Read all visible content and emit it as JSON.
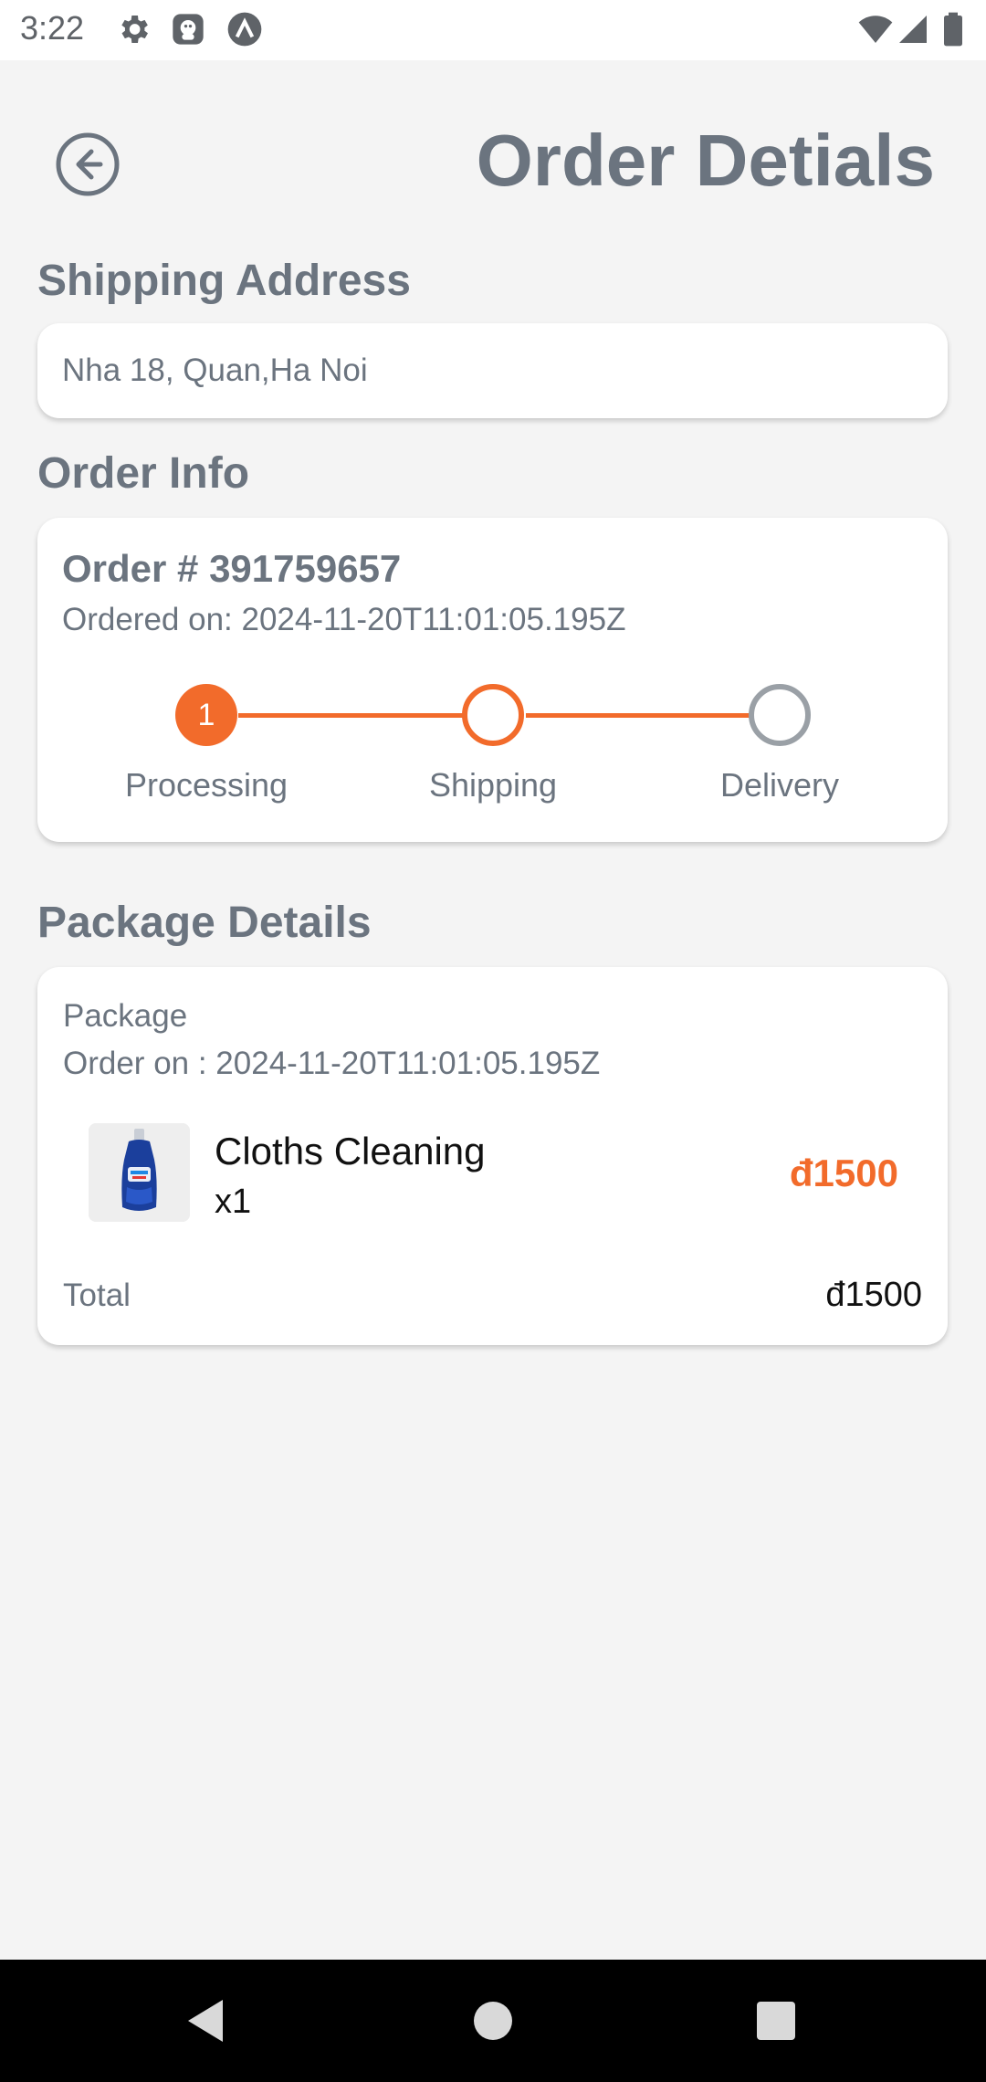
{
  "status_bar": {
    "time": "3:22",
    "left_icons": [
      "gear-icon",
      "app-notification-icon",
      "lambda-icon"
    ],
    "right_icons": [
      "wifi-icon",
      "cell-signal-icon",
      "battery-icon"
    ]
  },
  "header": {
    "back_icon": "arrow-left-circle-icon",
    "title": "Order Detials"
  },
  "shipping": {
    "section_title": "Shipping Address",
    "address": "Nha 18, Quan,Ha Noi"
  },
  "order_info": {
    "section_title": "Order Info",
    "order_number": "Order # 391759657",
    "ordered_on": "Ordered on: 2024-11-20T11:01:05.195Z",
    "steps": [
      {
        "label": "Processing",
        "marker": "1",
        "state": "completed"
      },
      {
        "label": "Shipping",
        "marker": "",
        "state": "current"
      },
      {
        "label": "Delivery",
        "marker": "",
        "state": "pending"
      }
    ]
  },
  "package": {
    "section_title": "Package Details",
    "label": "Package",
    "ordered_on": "Order on : 2024-11-20T11:01:05.195Z",
    "items": [
      {
        "name": "Cloths Cleaning",
        "quantity": "x1",
        "price": "đ1500",
        "image_icon": "detergent-bottle-icon"
      }
    ],
    "total_label": "Total",
    "total_value": "đ1500"
  },
  "nav_bar": {
    "icons": [
      "back-triangle-icon",
      "home-circle-icon",
      "recents-square-icon"
    ]
  },
  "colors": {
    "accent": "#f26b2b",
    "text_muted": "#6b747f",
    "background": "#f4f4f4",
    "card": "#ffffff"
  }
}
